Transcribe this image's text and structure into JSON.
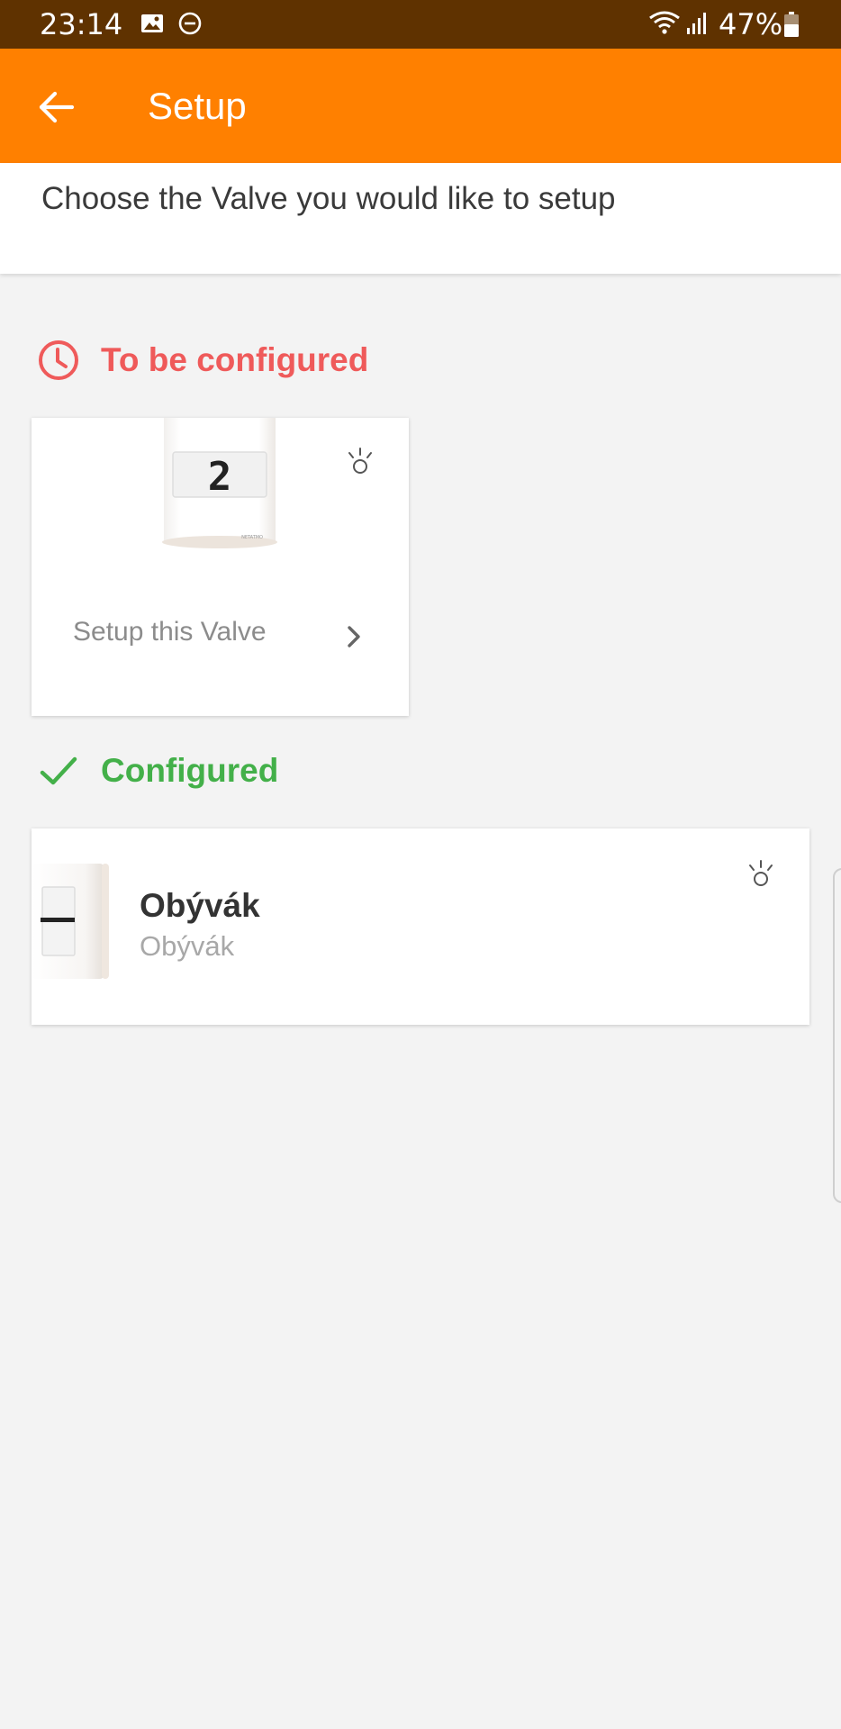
{
  "status_bar": {
    "time": "23:14",
    "battery_percent": "47%",
    "icons": [
      "gallery-icon",
      "do-not-disturb-icon",
      "wifi-icon",
      "signal-icon",
      "battery-icon"
    ],
    "background": "#5f3200"
  },
  "app_bar": {
    "title": "Setup",
    "back_icon": "arrow-left-icon",
    "background": "#ff8000"
  },
  "instruction": {
    "text": "Choose the Valve you would like to setup"
  },
  "sections": {
    "to_be_configured": {
      "label": "To be configured",
      "icon": "clock-icon",
      "color": "#ef5a5a",
      "valves": [
        {
          "display_digit": "2",
          "action_label": "Setup this Valve",
          "action_icon": "chevron-right-icon",
          "identify_icon": "light-bulb-icon"
        }
      ]
    },
    "configured": {
      "label": "Configured",
      "icon": "check-icon",
      "color": "#43b049",
      "valves": [
        {
          "name": "Obývák",
          "room": "Obývák",
          "identify_icon": "light-bulb-icon"
        }
      ]
    }
  }
}
